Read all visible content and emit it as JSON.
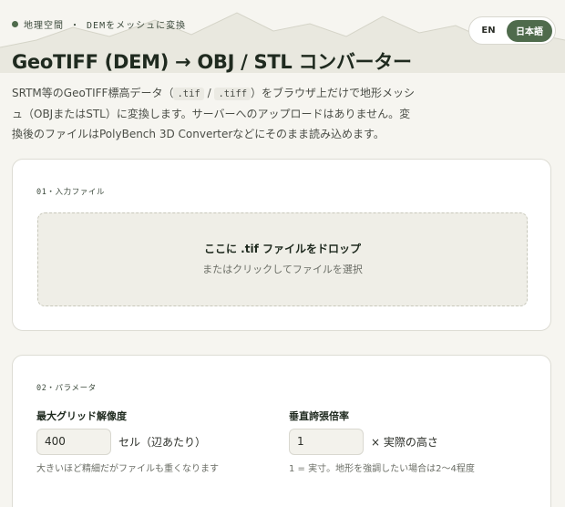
{
  "header": {
    "crumb": "地理空間 ・ DEMをメッシュに変換",
    "languages": [
      "EN",
      "日本語"
    ],
    "active_language": "日本語"
  },
  "title": "GeoTIFF (DEM) → OBJ / STL コンバーター",
  "intro": {
    "part1": "SRTM等のGeoTIFF標高データ（",
    "code1": ".tif",
    "sep": " / ",
    "code2": ".tiff",
    "part2": "）をブラウザ上だけで地形メッシュ（OBJまたはSTL）に変換します。サーバーへのアップロードはありません。変換後のファイルはPolyBench 3D Converterなどにそのまま読み込めます。"
  },
  "input_card": {
    "label": "01・入力ファイル",
    "dropzone_title": "ここに .tif ファイルをドロップ",
    "dropzone_sub": "またはクリックしてファイルを選択"
  },
  "params_card": {
    "label": "02・パラメータ",
    "grid": {
      "label": "最大グリッド解像度",
      "value": "400",
      "unit": "セル（辺あたり）",
      "hint": "大きいほど精細だがファイルも重くなります"
    },
    "exaggeration": {
      "label": "垂直誇張倍率",
      "value": "1",
      "unit": "× 実際の高さ",
      "hint": "1 = 実寸。地形を強調したい場合は2〜4程度"
    }
  },
  "colors": {
    "accent": "#4f6b4c",
    "background": "#f6f5f0"
  }
}
